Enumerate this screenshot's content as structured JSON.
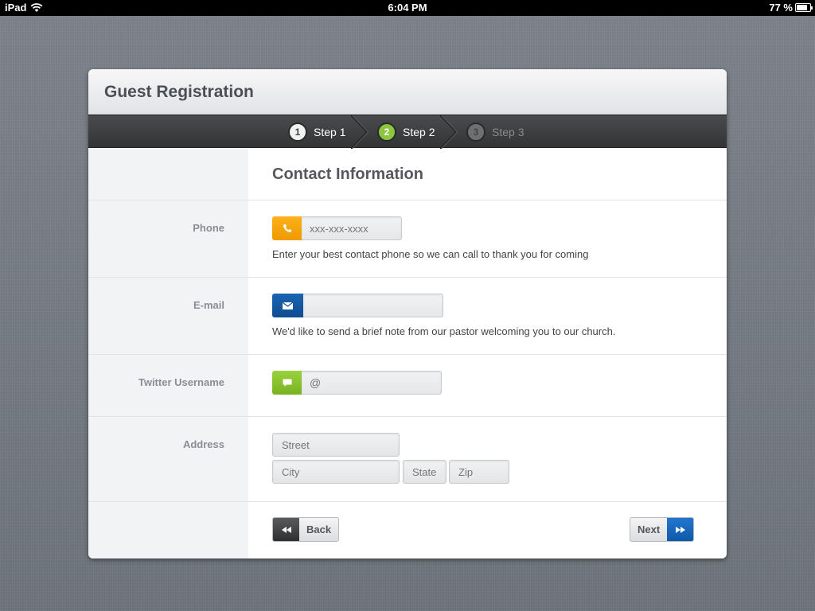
{
  "status_bar": {
    "device": "iPad",
    "time": "6:04 PM",
    "battery": "77 %"
  },
  "header": {
    "title": "Guest Registration"
  },
  "steps": [
    {
      "number": "1",
      "label": "Step 1",
      "state": "done"
    },
    {
      "number": "2",
      "label": "Step 2",
      "state": "active"
    },
    {
      "number": "3",
      "label": "Step 3",
      "state": "todo"
    }
  ],
  "form": {
    "section_title": "Contact Information",
    "phone": {
      "label": "Phone",
      "placeholder": "xxx-xxx-xxxx",
      "value": "",
      "help": "Enter your best contact phone so we can call to thank you for coming",
      "icon": "phone-icon"
    },
    "email": {
      "label": "E-mail",
      "placeholder": "",
      "value": "",
      "help": "We'd like to send a brief note from our pastor welcoming you to our church.",
      "icon": "envelope-icon"
    },
    "twitter": {
      "label": "Twitter Username",
      "placeholder": "@",
      "value": "",
      "icon": "speech-bubble-icon"
    },
    "address": {
      "label": "Address",
      "street_placeholder": "Street",
      "city_placeholder": "City",
      "state_placeholder": "State",
      "zip_placeholder": "Zip"
    }
  },
  "nav": {
    "back_label": "Back",
    "next_label": "Next"
  },
  "colors": {
    "phone_accent": "#f5a100",
    "email_accent": "#0f5299",
    "twitter_accent": "#86c232",
    "active_step": "#8cc63f",
    "next_accent": "#1164bd"
  }
}
